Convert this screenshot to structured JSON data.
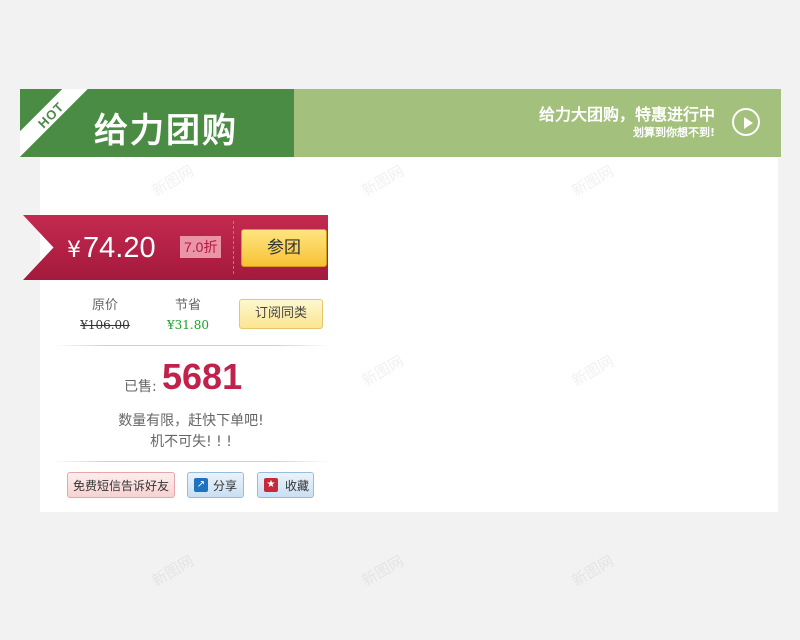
{
  "banner": {
    "hot_label": "HOT",
    "title": "给力团购",
    "slogan_main": "给力大团购，特惠进行中",
    "slogan_sub": "划算到你想不到!",
    "play_icon": "play-circle-icon"
  },
  "deal": {
    "currency": "¥",
    "price": "74.20",
    "discount": "7.0折",
    "join_label": "参团",
    "original_label": "原价",
    "original_price": "¥106.00",
    "saving_label": "节省",
    "saving_amount": "¥31.80",
    "subscribe_label": "订阅同类",
    "sold_label": "已售:",
    "sold_count": "5681",
    "message_line1": "数量有限，赶快下单吧!",
    "message_line2": "机不可失! ! !"
  },
  "actions": {
    "sms_label": "免费短信告诉好友",
    "share_label": "分享",
    "share_icon": "share-icon",
    "favorite_label": "收藏",
    "favorite_icon": "star-icon"
  },
  "colors": {
    "banner_dark": "#4b8c45",
    "banner_light": "#a3c17c",
    "price_bar": "#b3193c",
    "join_button": "#f7c135",
    "sold_count": "#c0224b",
    "saving": "#1aa02a"
  },
  "watermark": "新图网"
}
